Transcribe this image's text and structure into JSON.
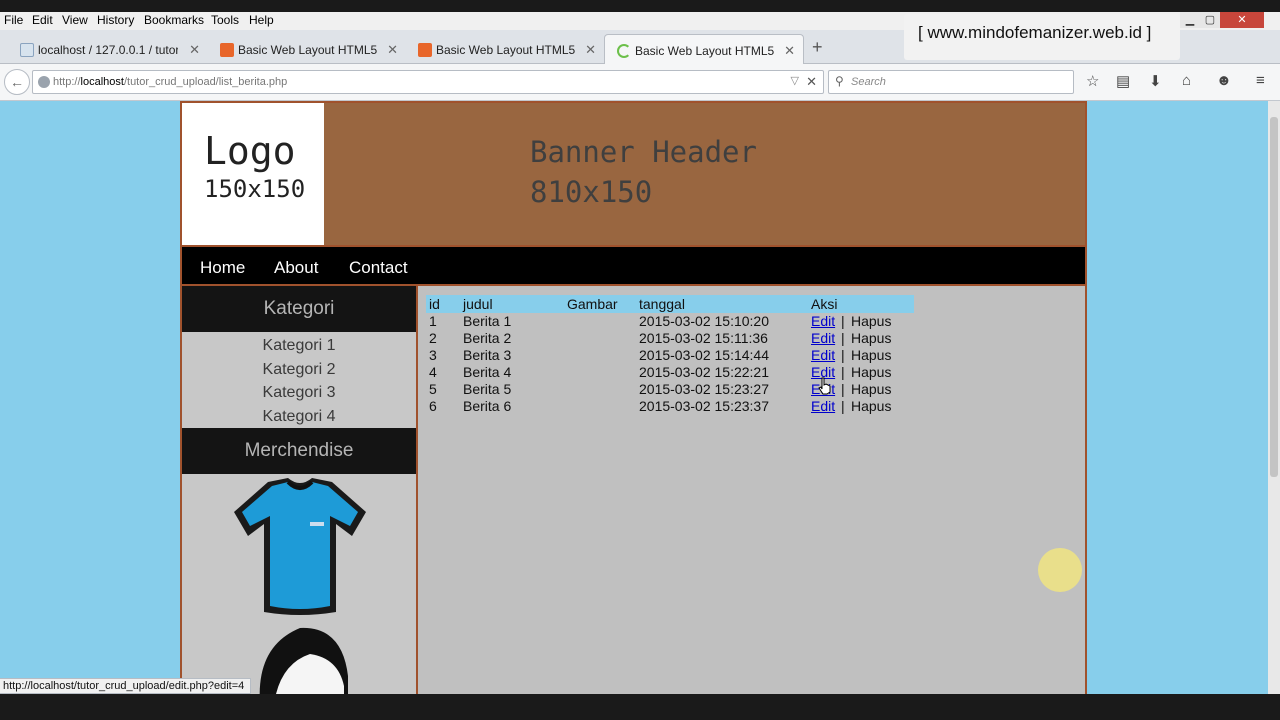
{
  "menubar": {
    "items": [
      "File",
      "Edit",
      "View",
      "History",
      "Bookmarks",
      "Tools",
      "Help"
    ]
  },
  "tabs": [
    {
      "title": "localhost / 127.0.0.1 / tutor...",
      "active": false
    },
    {
      "title": "Basic Web Layout HTML5 ...",
      "active": false
    },
    {
      "title": "Basic Web Layout HTML5 ...",
      "active": false
    },
    {
      "title": "Basic Web Layout HTML5 ...",
      "active": true
    }
  ],
  "watermark": "[ www.mindofemanizer.web.id ]",
  "address": {
    "prefix": "http://",
    "host": "localhost",
    "path": "/tutor_crud_upload/list_berita.php"
  },
  "search": {
    "placeholder": "Search"
  },
  "toolbar_icons": [
    "star-icon",
    "reading-list-icon",
    "download-icon",
    "home-icon",
    "chat-icon",
    "menu-icon"
  ],
  "site": {
    "logo": {
      "line1": "Logo",
      "line2": "150x150"
    },
    "banner": {
      "line1": "Banner Header",
      "line2": "810x150"
    },
    "nav": [
      "Home",
      "About",
      "Contact"
    ],
    "sidebar": {
      "kategori_title": "Kategori",
      "kategori": [
        "Kategori 1",
        "Kategori 2",
        "Kategori 3",
        "Kategori 4"
      ],
      "merch_title": "Merchendise"
    },
    "table": {
      "headers": [
        "id",
        "judul",
        "Gambar",
        "tanggal",
        "Aksi"
      ],
      "rows": [
        {
          "id": "1",
          "judul": "Berita 1",
          "gambar": "",
          "tanggal": "2015-03-02 15:10:20",
          "edit": "Edit",
          "sep": "|",
          "hapus": "Hapus"
        },
        {
          "id": "2",
          "judul": "Berita 2",
          "gambar": "",
          "tanggal": "2015-03-02 15:11:36",
          "edit": "Edit",
          "sep": "|",
          "hapus": "Hapus"
        },
        {
          "id": "3",
          "judul": "Berita 3",
          "gambar": "",
          "tanggal": "2015-03-02 15:14:44",
          "edit": "Edit",
          "sep": "|",
          "hapus": "Hapus"
        },
        {
          "id": "4",
          "judul": "Berita 4",
          "gambar": "",
          "tanggal": "2015-03-02 15:22:21",
          "edit": "Edit",
          "sep": "|",
          "hapus": "Hapus"
        },
        {
          "id": "5",
          "judul": "Berita 5",
          "gambar": "",
          "tanggal": "2015-03-02 15:23:27",
          "edit": "Edit",
          "sep": "|",
          "hapus": "Hapus"
        },
        {
          "id": "6",
          "judul": "Berita 6",
          "gambar": "",
          "tanggal": "2015-03-02 15:23:37",
          "edit": "Edit",
          "sep": "|",
          "hapus": "Hapus"
        }
      ]
    }
  },
  "status_url": "http://localhost/tutor_crud_upload/edit.php?edit=4",
  "colors": {
    "page_bg": "#87ceeb",
    "banner": "#996640",
    "border": "#a0522d",
    "content_bg": "#c0c0c0",
    "link": "#0000cc"
  }
}
